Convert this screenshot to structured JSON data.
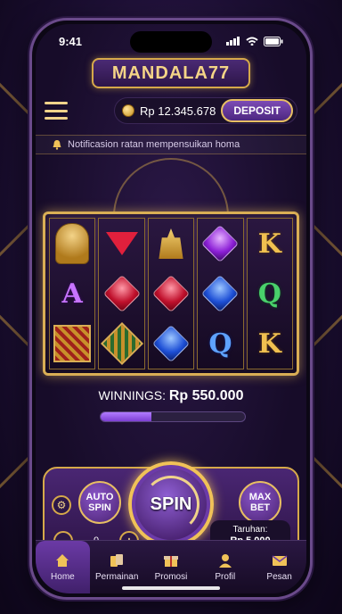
{
  "status": {
    "time": "9:41",
    "icons": [
      "signal-icon",
      "wifi-icon",
      "battery-icon"
    ]
  },
  "brand": {
    "logo_text": "MANDALA77",
    "accent": "#d6a94a",
    "primary": "#4a2673"
  },
  "topbar": {
    "balance": "Rp 12.345.678",
    "deposit_label": "DEPOSIT"
  },
  "notification": {
    "text": "Notificasion ratan mempensuikan homa"
  },
  "reels": [
    [
      "ganesha",
      "A",
      "pattern-red"
    ],
    [
      "ruby",
      "ruby",
      "pattern-green"
    ],
    [
      "temple",
      "ruby",
      "sapphire"
    ],
    [
      "amethyst",
      "sapphire",
      "Q"
    ],
    [
      "K",
      "Q",
      "K"
    ]
  ],
  "winnings": {
    "label": "WINNINGS:",
    "amount": "Rp 550.000"
  },
  "progress": {
    "value": 0.35
  },
  "controls": {
    "auto_spin_label": "AUTO SPIN",
    "spin_label": "SPIN",
    "max_bet_label": "MAX BET",
    "stepper_value": "0",
    "bet_title": "Taruhan:",
    "bet_value": "Rp 5.000"
  },
  "tabs": [
    {
      "label": "Home",
      "icon": "home-icon",
      "active": true
    },
    {
      "label": "Permainan",
      "icon": "cards-icon",
      "active": false
    },
    {
      "label": "Promosi",
      "icon": "gift-icon",
      "active": false
    },
    {
      "label": "Profil",
      "icon": "user-icon",
      "active": false
    },
    {
      "label": "Pesan",
      "icon": "mail-icon",
      "active": false
    }
  ]
}
